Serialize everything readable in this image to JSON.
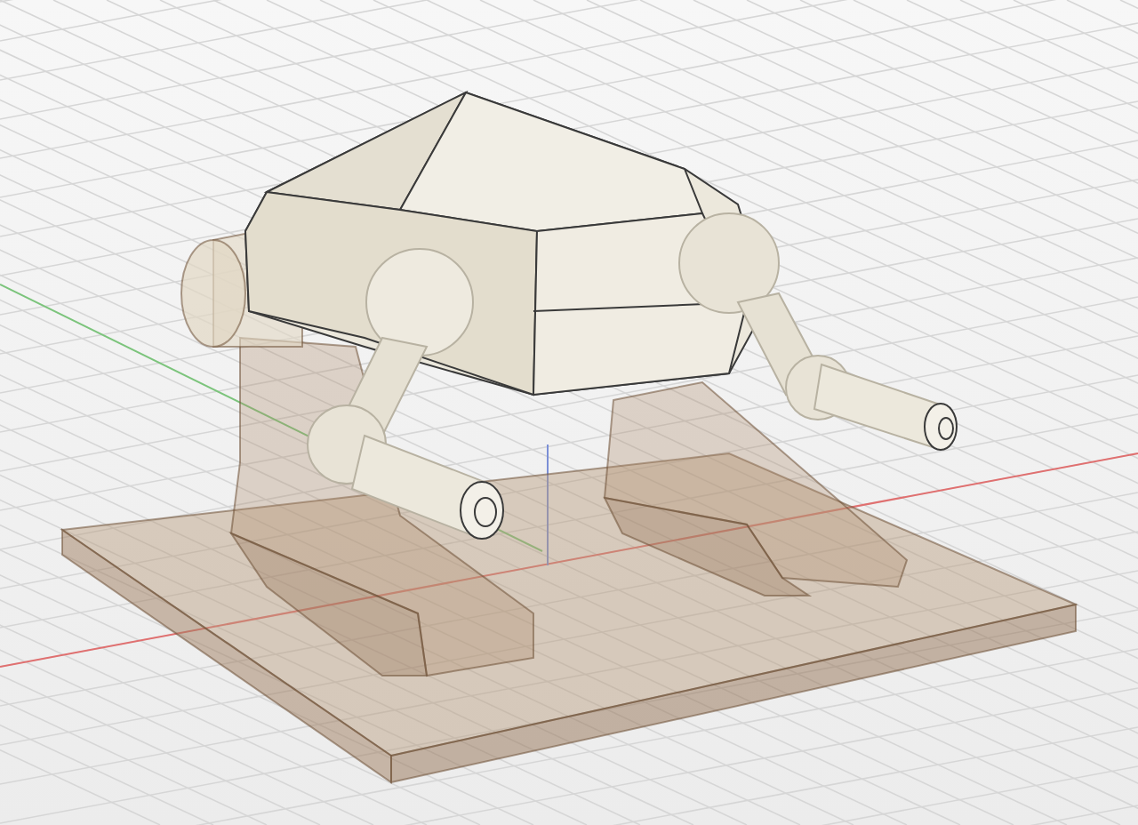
{
  "viewport": {
    "grid_visible": true,
    "axes_visible": true
  }
}
